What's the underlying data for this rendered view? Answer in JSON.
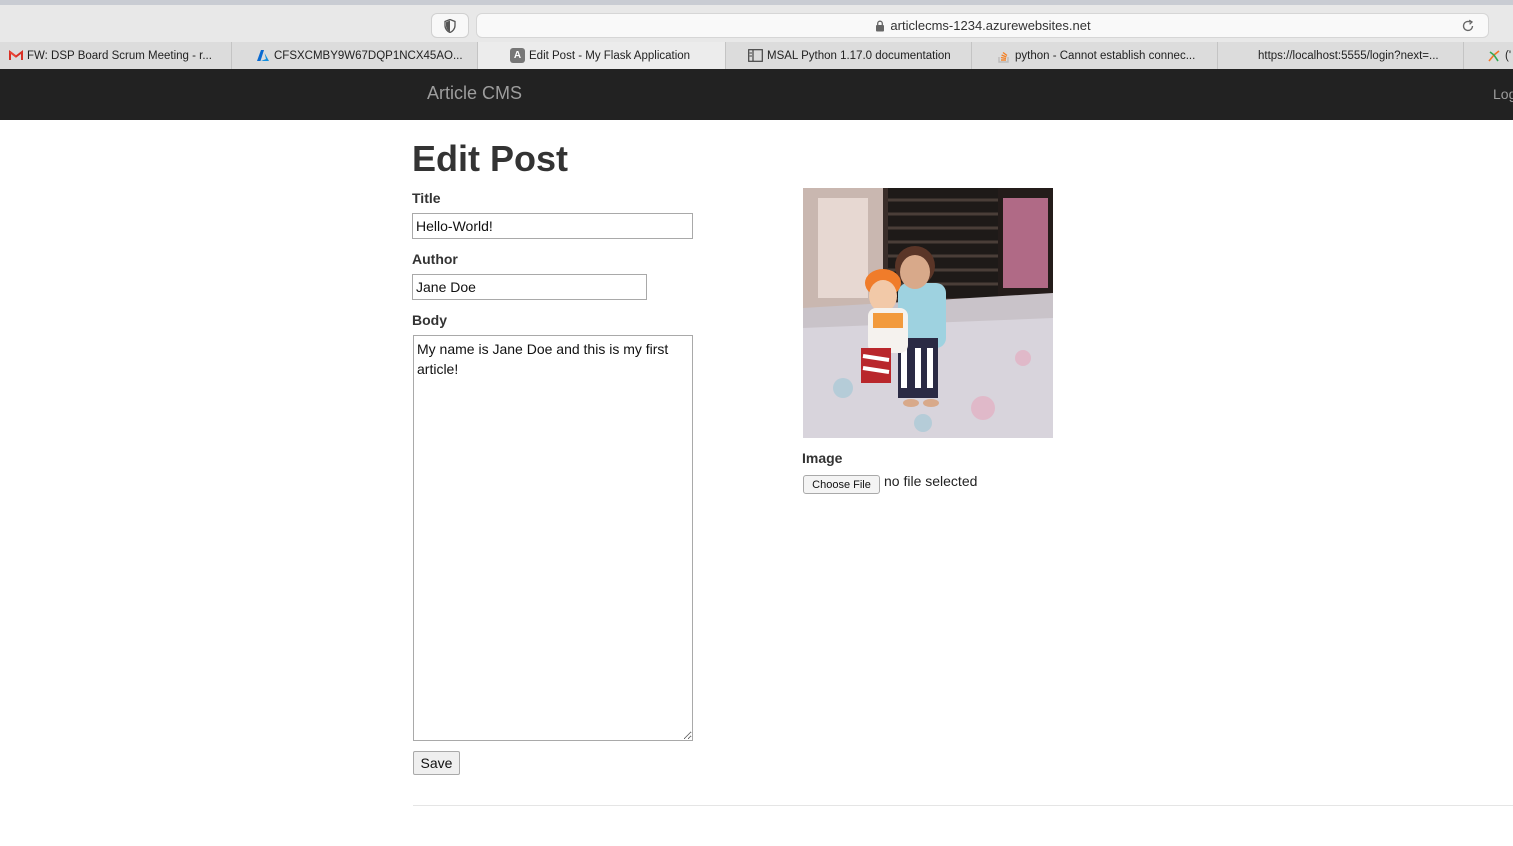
{
  "browser": {
    "url": "articlecms-1234.azurewebsites.net",
    "tabs": [
      {
        "label": "FW: DSP Board Scrum Meeting - r...",
        "icon": "gmail-icon"
      },
      {
        "label": "CFSXCMBY9W67DQP1NCX45AO...",
        "icon": "azure-icon"
      },
      {
        "label": "Edit Post - My Flask Application",
        "icon": "letter-a-icon",
        "active": true
      },
      {
        "label": "MSAL Python 1.17.0 documentation",
        "icon": "docs-icon"
      },
      {
        "label": "python - Cannot establish connec...",
        "icon": "stackoverflow-icon"
      },
      {
        "label": "https://localhost:5555/login?next=...",
        "icon": ""
      },
      {
        "label": "('",
        "icon": "jupyter-icon"
      }
    ]
  },
  "navbar": {
    "brand": "Article CMS",
    "link": "Log"
  },
  "page": {
    "heading": "Edit Post",
    "title_label": "Title",
    "title_value": "Hello-World!",
    "author_label": "Author",
    "author_value": "Jane Doe",
    "body_label": "Body",
    "body_value": "My name is Jane Doe and this is my first article!",
    "save_label": "Save",
    "image_label": "Image",
    "choose_file_label": "Choose File",
    "no_file_text": "no file selected"
  },
  "colors": {
    "navbar": "#222222",
    "brand_text": "#9d9d9d",
    "text": "#333333"
  }
}
